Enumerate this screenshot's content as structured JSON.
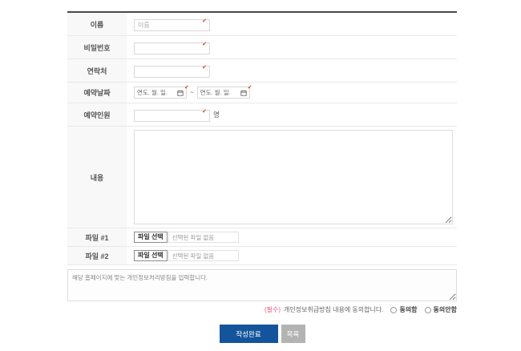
{
  "form": {
    "rows": [
      {
        "label": "이름",
        "placeholder": "이름"
      },
      {
        "label": "비밀번호"
      },
      {
        "label": "연락처"
      },
      {
        "label": "예약날짜",
        "date_placeholder": "연도. 월. 일.",
        "separator": "~"
      },
      {
        "label": "예약인원",
        "suffix": "명"
      },
      {
        "label": "내용"
      },
      {
        "label": "파일 #1",
        "button": "파일 선택",
        "status": "선택된 파일 없음"
      },
      {
        "label": "파일 #2",
        "button": "파일 선택",
        "status": "선택된 파일 없음"
      }
    ],
    "required_mark": "✔"
  },
  "privacy": {
    "text": "해당 홈페이지에 맞는 개인정보처리방침을 입력합니다."
  },
  "agreement": {
    "required_tag": "(필수)",
    "text": "개인정보취급방침 내용에 동의합니다.",
    "agree_label": "동의함",
    "disagree_label": "동의안함"
  },
  "actions": {
    "submit_label": "작성완료",
    "list_label": "목록"
  },
  "colors": {
    "primary_button": "#14549c",
    "list_button": "#b3b3b3",
    "required_mark": "#d9442c",
    "required_tag": "#f0587c"
  }
}
